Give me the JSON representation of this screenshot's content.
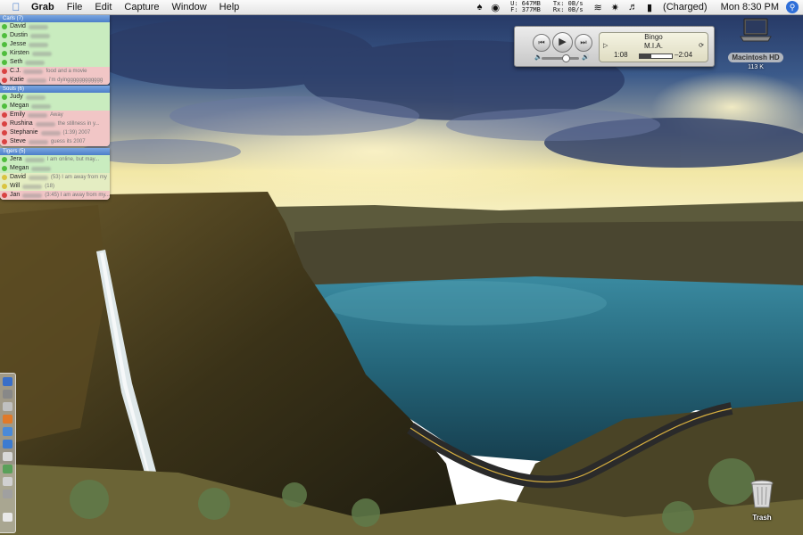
{
  "menubar": {
    "app_name": "Grab",
    "menus": [
      "File",
      "Edit",
      "Capture",
      "Window",
      "Help"
    ],
    "memory_used": "U: 647MB",
    "memory_free": "F: 377MB",
    "net_tx": "Tx: 0B/s",
    "net_rx": "Rx: 0B/s",
    "battery": "(Charged)",
    "clock": "Mon 8:30 PM",
    "icons": [
      "apple-icon",
      "status-icon",
      "timemachine-icon",
      "bluetooth-icon",
      "wifi-icon",
      "volume-icon",
      "battery-icon",
      "spotlight-icon"
    ]
  },
  "buddy_list": {
    "groups": [
      {
        "name": "Carls (7)",
        "buddies": [
          {
            "name": "David",
            "status_text": "",
            "state": "available"
          },
          {
            "name": "Dustin",
            "status_text": "",
            "state": "available"
          },
          {
            "name": "Jesse",
            "status_text": "",
            "state": "available"
          },
          {
            "name": "Kirsten",
            "status_text": "",
            "state": "available"
          },
          {
            "name": "Seth",
            "status_text": "",
            "state": "available"
          },
          {
            "name": "C.J.",
            "status_text": "food and a movie",
            "state": "away"
          },
          {
            "name": "Katie",
            "status_text": "i'm dyingggggggggggg",
            "state": "away"
          }
        ]
      },
      {
        "name": "Souls (6)",
        "buddies": [
          {
            "name": "Judy",
            "status_text": "",
            "state": "available"
          },
          {
            "name": "Megan",
            "status_text": "",
            "state": "available"
          },
          {
            "name": "Emily",
            "status_text": "Away",
            "state": "away"
          },
          {
            "name": "Rushina",
            "status_text": "the stillness in y...",
            "state": "away"
          },
          {
            "name": "Stephanie",
            "status_text": "(1:39) 2007",
            "state": "away"
          },
          {
            "name": "Steve",
            "status_text": "guess its 2007",
            "state": "away"
          }
        ]
      },
      {
        "name": "Tigers (5)",
        "buddies": [
          {
            "name": "Jera",
            "status_text": "I am online, but may...",
            "state": "available"
          },
          {
            "name": "Megan",
            "status_text": "",
            "state": "available"
          },
          {
            "name": "David",
            "status_text": "(53) I am away from my",
            "state": "idle"
          },
          {
            "name": "Will",
            "status_text": "(18)",
            "state": "idle"
          },
          {
            "name": "Jan",
            "status_text": "(3:45) I am away from my...",
            "state": "away"
          }
        ]
      }
    ]
  },
  "itunes": {
    "song": "Bingo",
    "artist": "M.I.A.",
    "elapsed": "1:08",
    "remaining": "–2:04",
    "progress_fraction": 0.36,
    "volume_fraction": 0.65,
    "buttons": {
      "previous": "⏮",
      "play": "▶",
      "next": "⏭"
    }
  },
  "desktop_icons": {
    "hard_drive_label": "Macintosh HD",
    "hard_drive_size": "113 K",
    "trash_label": "Trash"
  },
  "colors": {
    "sky_top": "#2a3a6a",
    "sunset": "#f2e6a0",
    "lake": "#2a6b82",
    "cliff": "#3a3418",
    "accent_blue": "#2f6fd8"
  }
}
